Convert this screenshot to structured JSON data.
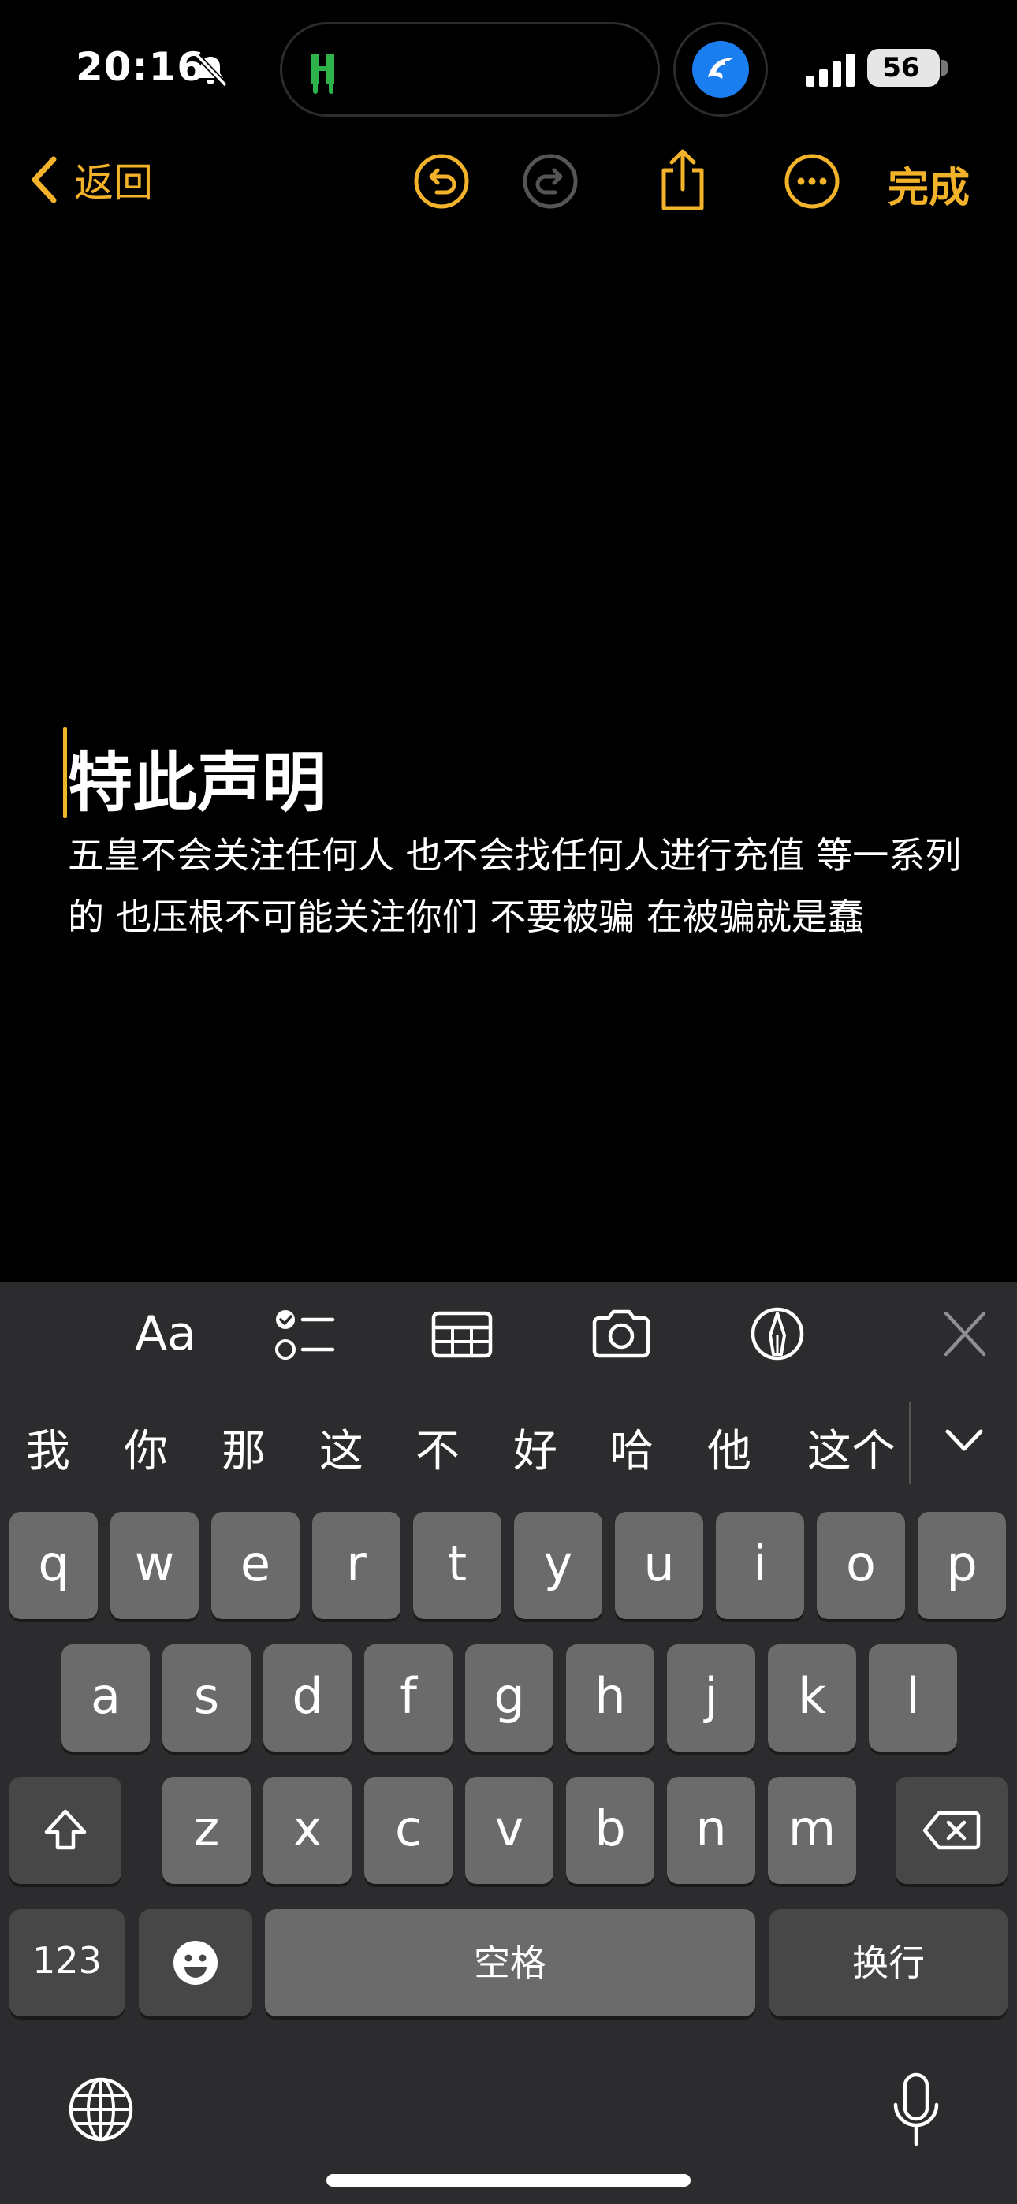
{
  "status_bar": {
    "time": "20:16",
    "battery": "56",
    "icons": [
      "bell-slash-icon",
      "app-activity-icon",
      "dolphin-app-icon",
      "cellular-signal-icon",
      "battery-icon"
    ]
  },
  "nav": {
    "back_label": "返回",
    "done_label": "完成",
    "icons": [
      "chevron-left-icon",
      "undo-icon",
      "redo-icon",
      "share-icon",
      "more-icon"
    ]
  },
  "note": {
    "title": "特此声明",
    "body": "五皇不会关注任何人 也不会找任何人进行充值 等一系列的 也压根不可能关注你们 不要被骗 在被骗就是蠢"
  },
  "format_toolbar": {
    "text_style_label": "Aa",
    "icons": [
      "checklist-icon",
      "table-icon",
      "camera-icon",
      "markup-pen-icon",
      "close-icon"
    ]
  },
  "keyboard": {
    "candidates": [
      "我",
      "你",
      "那",
      "这",
      "不",
      "好",
      "哈",
      "他",
      "这个"
    ],
    "row1": [
      "q",
      "w",
      "e",
      "r",
      "t",
      "y",
      "u",
      "i",
      "o",
      "p"
    ],
    "row2": [
      "a",
      "s",
      "d",
      "f",
      "g",
      "h",
      "j",
      "k",
      "l"
    ],
    "row3": [
      "z",
      "x",
      "c",
      "v",
      "b",
      "n",
      "m"
    ],
    "numbers_label": "123",
    "space_label": "空格",
    "return_label": "换行"
  },
  "colors": {
    "accent": "#f2b229",
    "background": "#000000",
    "keyboard_bg": "#2c2c2e",
    "key": "#6b6b6b",
    "key_function": "#474747"
  }
}
